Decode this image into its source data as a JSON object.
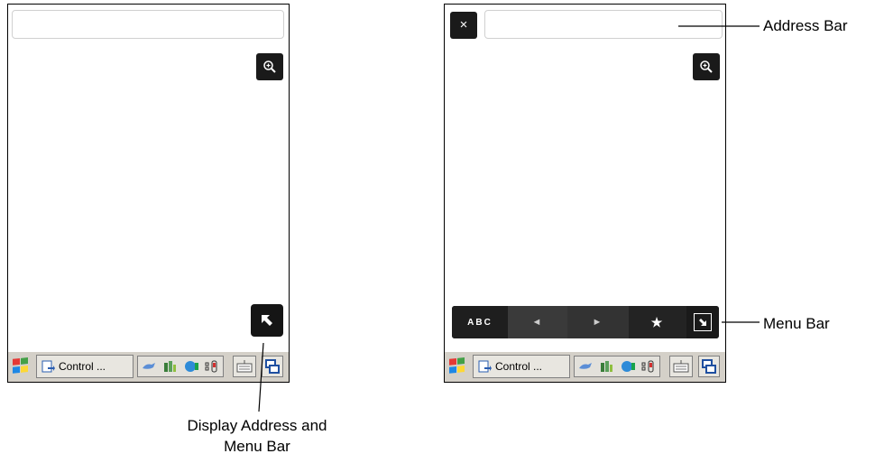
{
  "screens": {
    "left": {
      "taskbar": {
        "task_label": "Control ..."
      },
      "buttons": [
        "zoom",
        "display-address-and-menu-bar"
      ]
    },
    "right": {
      "close_glyph": "×",
      "menu_bar": {
        "abc_label": "ABC",
        "back_glyph": "◄",
        "forward_glyph": "►",
        "favorites_glyph": "★"
      },
      "taskbar": {
        "task_label": "Control ..."
      }
    }
  },
  "callouts": {
    "address_bar": "Address Bar",
    "menu_bar": "Menu Bar",
    "display_line1": "Display Address and",
    "display_line2": "Menu Bar"
  },
  "icons": [
    "windows-start-icon",
    "control-panel-icon",
    "network-icon",
    "battery-icon",
    "globe-icon",
    "signal-icon",
    "keyboard-icon",
    "switch-windows-icon",
    "zoom-icon",
    "close-icon",
    "back-icon",
    "forward-icon",
    "star-icon",
    "collapse-arrow-icon",
    "expand-arrow-icon"
  ]
}
